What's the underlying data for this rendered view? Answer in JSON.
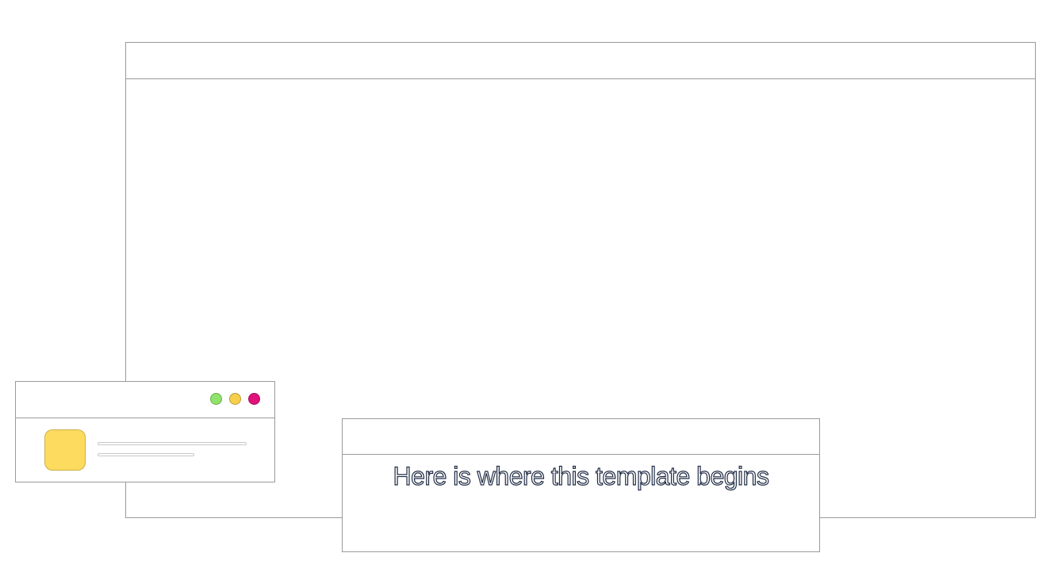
{
  "caption": {
    "text": "Here is where this template begins",
    "outline_color": "#1f2a44"
  },
  "small_window": {
    "controls": [
      {
        "name": "green-dot",
        "color": "#8fe36a"
      },
      {
        "name": "yellow-dot",
        "color": "#f7cf4b"
      },
      {
        "name": "pink-dot",
        "color": "#e0117a"
      }
    ],
    "app_tile_color": "#fddb5e"
  },
  "colors": {
    "border": "#9a9a9a",
    "background": "#ffffff"
  }
}
